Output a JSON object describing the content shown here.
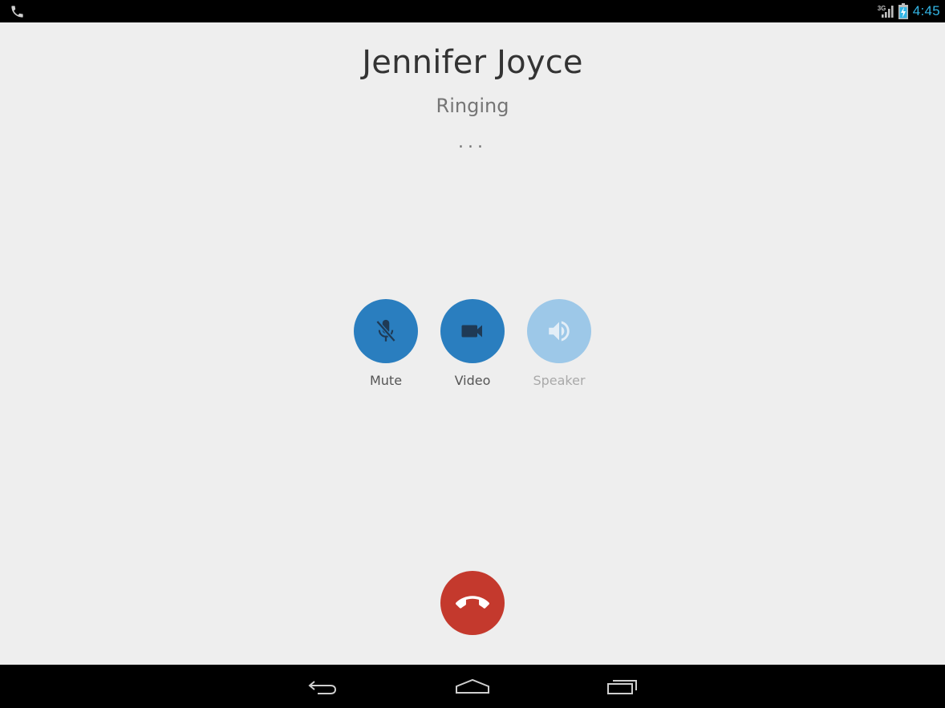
{
  "status_bar": {
    "network_type": "3G",
    "clock": "4:45",
    "icons": [
      "phone-icon",
      "signal-icon",
      "battery-charging-icon"
    ],
    "clock_color": "#33b5e5"
  },
  "call": {
    "caller_name": "Jennifer Joyce",
    "status": "Ringing",
    "progress_dots": "...",
    "end_call_color": "#c4392d"
  },
  "controls": {
    "accent_color": "#2a7ebf",
    "disabled_color": "#9dc8e8",
    "mute": {
      "label": "Mute",
      "icon": "mic-off-icon",
      "enabled": true
    },
    "video": {
      "label": "Video",
      "icon": "videocam-icon",
      "enabled": true
    },
    "speaker": {
      "label": "Speaker",
      "icon": "volume-up-icon",
      "enabled": false
    }
  },
  "navigation": {
    "buttons": [
      "back-icon",
      "home-icon",
      "recents-icon"
    ]
  }
}
